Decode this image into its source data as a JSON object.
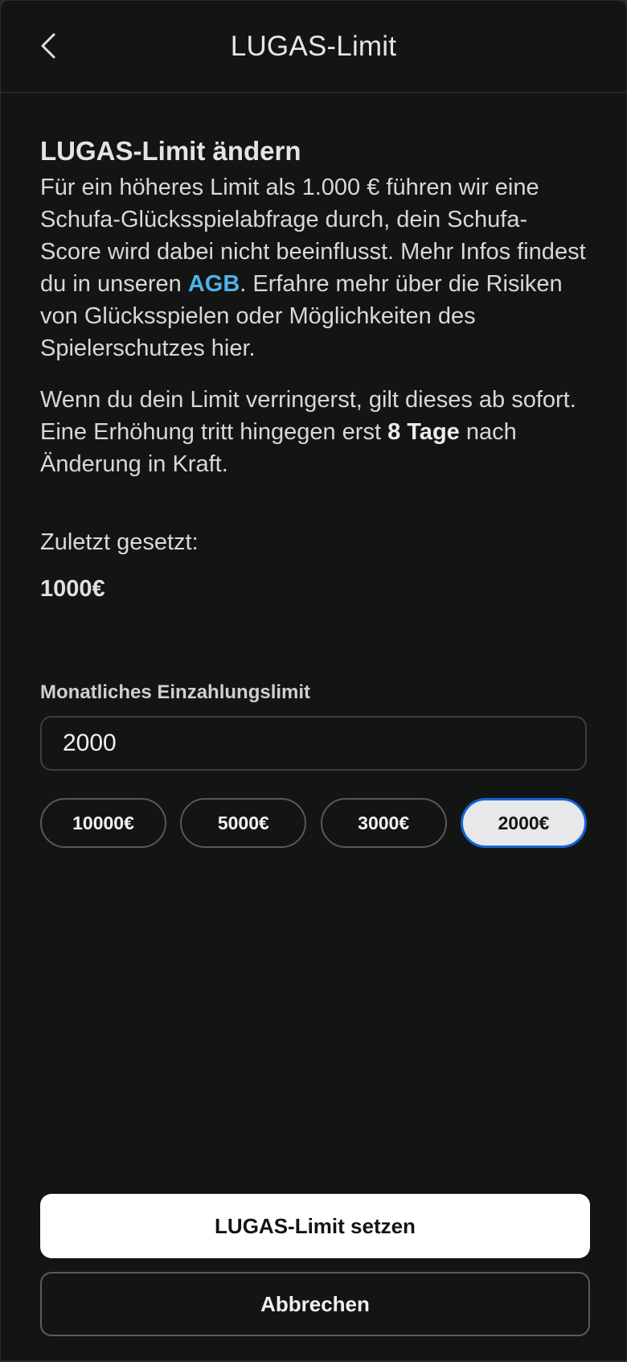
{
  "header": {
    "title": "LUGAS-Limit",
    "back_icon": "chevron-left-icon"
  },
  "info": {
    "heading": "LUGAS-Limit ändern",
    "para1_before": "Für ein höheres Limit als 1.000 € führen wir eine Schufa-Glücksspielabfrage durch, dein Schufa-Score wird dabei nicht beeinflusst. Mehr Infos findest du in unseren ",
    "para1_link": "AGB",
    "para1_after": ". Erfahre mehr über die Risiken von Glücksspielen oder Möglichkeiten des Spielerschutzes hier.",
    "para2_before": "Wenn du dein Limit verringerst, gilt dieses ab sofort. Eine Erhöhung tritt hingegen erst ",
    "para2_bold": "8 Tage",
    "para2_after": " nach Änderung in Kraft."
  },
  "last_set": {
    "label": "Zuletzt gesetzt:",
    "value": "1000€"
  },
  "deposit_limit": {
    "label": "Monatliches Einzahlungslimit",
    "value": "2000",
    "options": [
      "10000€",
      "5000€",
      "3000€",
      "2000€"
    ],
    "selected": "2000€"
  },
  "actions": {
    "primary_label": "LUGAS-Limit setzen",
    "secondary_label": "Abbrechen"
  },
  "colors": {
    "background": "#131414",
    "link": "#4fb2e6",
    "selected_border": "#1464d6"
  }
}
